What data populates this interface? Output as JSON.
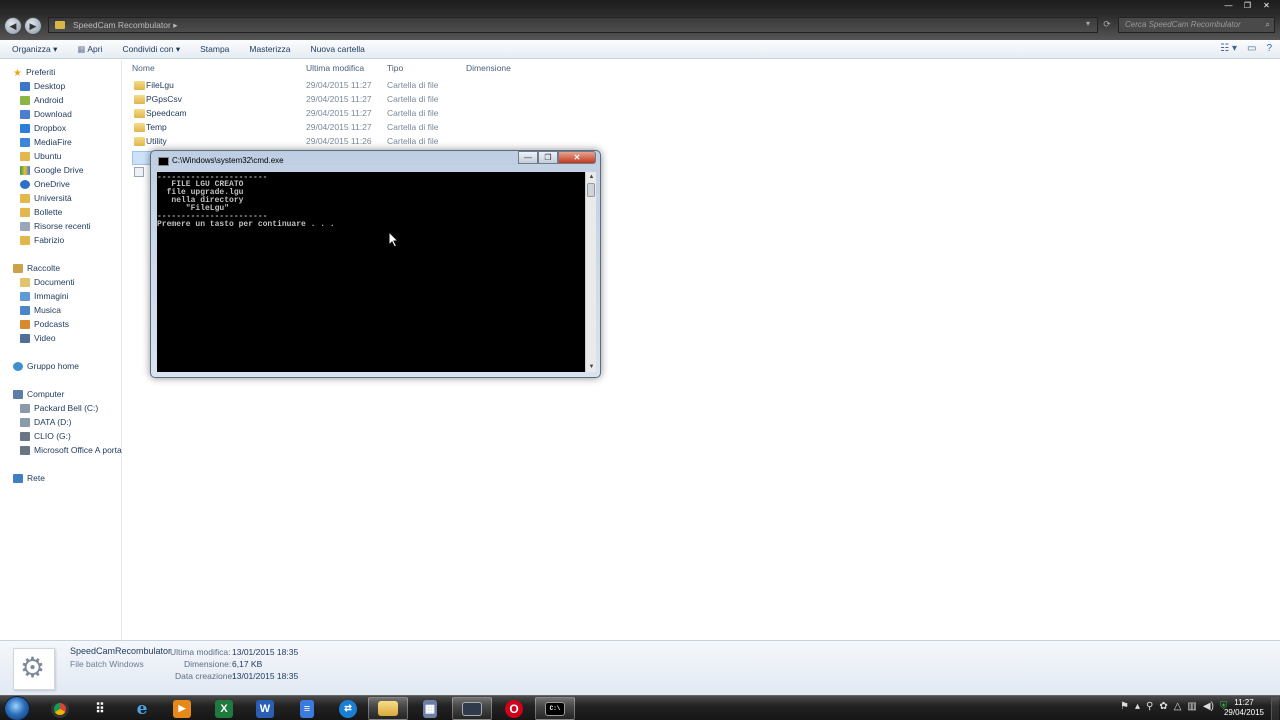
{
  "window": {
    "address_path": "SpeedCam Recombulator",
    "search_placeholder": "Cerca SpeedCam Recombulator",
    "controls": {
      "minimize": "—",
      "restore": "❐",
      "close": "✕"
    }
  },
  "toolbar": {
    "items": [
      "Organizza ▾",
      "Apri",
      "Condividi con ▾",
      "Stampa",
      "Masterizza",
      "Nuova cartella"
    ]
  },
  "sidebar": {
    "favorites_header": "Preferiti",
    "favorites": [
      "Desktop",
      "Android",
      "Download",
      "Dropbox",
      "MediaFire",
      "Ubuntu",
      "Google Drive",
      "OneDrive",
      "Università",
      "Bollette",
      "Risorse recenti",
      "Fabrizio"
    ],
    "libraries_header": "Raccolte",
    "libraries": [
      "Documenti",
      "Immagini",
      "Musica",
      "Podcasts",
      "Video"
    ],
    "homegroup": "Gruppo home",
    "computer_header": "Computer",
    "drives": [
      "Packard Bell (C:)",
      "DATA (D:)",
      "CLIO (G:)",
      "Microsoft Office A porta"
    ],
    "network": "Rete"
  },
  "filelist": {
    "columns": {
      "name": "Nome",
      "modified": "Ultima modifica",
      "type": "Tipo",
      "size": "Dimensione"
    },
    "rows": [
      {
        "name": "FileLgu",
        "modified": "29/04/2015 11:27",
        "type": "Cartella di file"
      },
      {
        "name": "PGpsCsv",
        "modified": "29/04/2015 11:27",
        "type": "Cartella di file"
      },
      {
        "name": "Speedcam",
        "modified": "29/04/2015 11:27",
        "type": "Cartella di file"
      },
      {
        "name": "Temp",
        "modified": "29/04/2015 11:27",
        "type": "Cartella di file"
      },
      {
        "name": "Utility",
        "modified": "29/04/2015 11:26",
        "type": "Cartella di file"
      }
    ]
  },
  "cmd": {
    "title": "C:\\Windows\\system32\\cmd.exe",
    "lines": [
      "-----------------------",
      "   FILE LGU CREATO",
      "  file upgrade.lgu",
      "   nella directory",
      "      \"FileLgu\"",
      "-----------------------",
      "Premere un tasto per continuare . . ."
    ]
  },
  "details": {
    "file_name": "SpeedCamRecombulator",
    "file_type": "File batch Windows",
    "modified_label": "Ultima modifica:",
    "modified_value": "13/01/2015 18:35",
    "size_label": "Dimensione:",
    "size_value": "6,17 KB",
    "created_label": "Data creazione:",
    "created_value": "13/01/2015 18:35"
  },
  "taskbar": {
    "apps": [
      "chrome-icon",
      "apps-grid-icon",
      "ie-icon",
      "media-player-icon",
      "excel-icon",
      "word-icon",
      "docs-icon",
      "teamviewer-icon",
      "explorer-icon",
      "calculator-icon",
      "remote-desktop-icon",
      "opera-icon",
      "cmd-icon"
    ],
    "app_letters": {
      "excel": "X",
      "word": "W",
      "opera": "O",
      "cmd": "C:\\"
    },
    "clock_time": "11:27",
    "clock_date": "29/04/2015"
  }
}
